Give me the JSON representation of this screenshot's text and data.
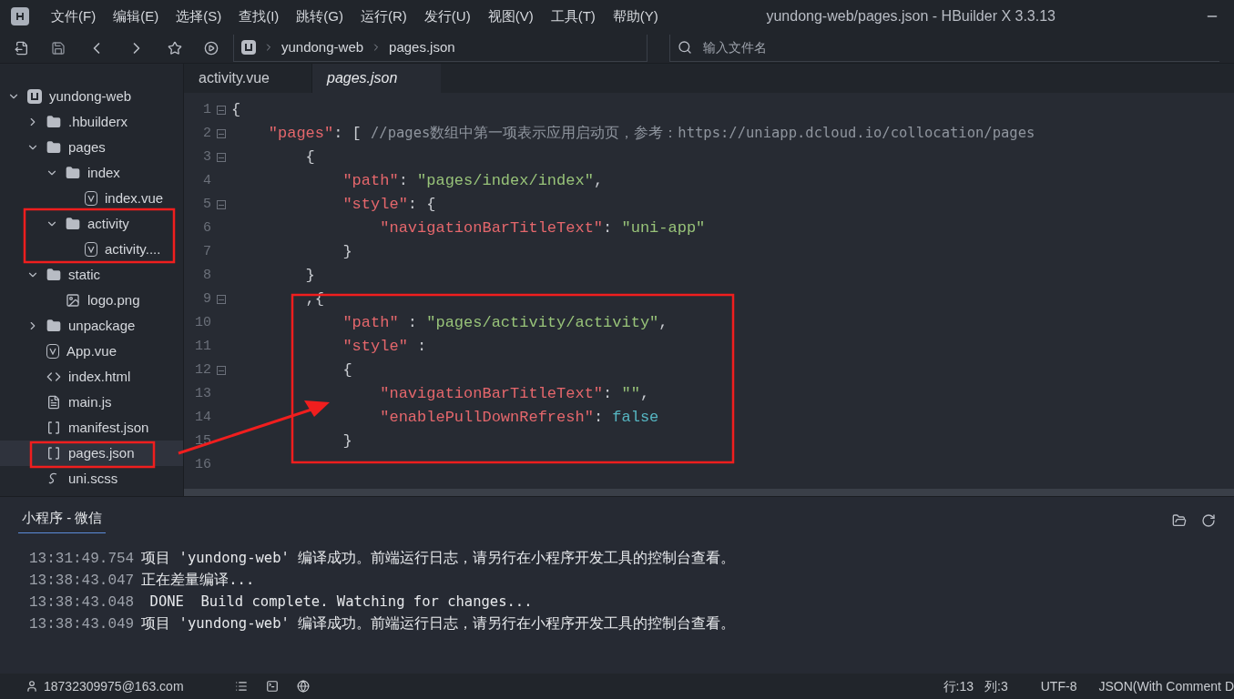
{
  "window": {
    "title": "yundong-web/pages.json - HBuilder X 3.3.13"
  },
  "menu": [
    "文件(F)",
    "编辑(E)",
    "选择(S)",
    "查找(I)",
    "跳转(G)",
    "运行(R)",
    "发行(U)",
    "视图(V)",
    "工具(T)",
    "帮助(Y)"
  ],
  "breadcrumb": [
    "yundong-web",
    "pages.json"
  ],
  "file_search": {
    "placeholder": "输入文件名"
  },
  "tree": [
    {
      "name": "yundong-web",
      "kind": "project",
      "expanded": true,
      "selected": false,
      "children": [
        {
          "name": ".hbuilderx",
          "kind": "folder",
          "expanded": false,
          "selected": false
        },
        {
          "name": "pages",
          "kind": "folder",
          "expanded": true,
          "selected": false,
          "children": [
            {
              "name": "index",
              "kind": "folder",
              "expanded": true,
              "selected": false,
              "children": [
                {
                  "name": "index.vue",
                  "kind": "vue",
                  "selected": false
                }
              ]
            },
            {
              "name": "activity",
              "kind": "folder",
              "expanded": true,
              "selected": false,
              "children": [
                {
                  "name": "activity....",
                  "kind": "vue",
                  "selected": false
                }
              ]
            }
          ]
        },
        {
          "name": "static",
          "kind": "folder",
          "expanded": true,
          "selected": false,
          "children": [
            {
              "name": "logo.png",
              "kind": "image",
              "selected": false
            }
          ]
        },
        {
          "name": "unpackage",
          "kind": "folder",
          "expanded": false,
          "selected": false
        },
        {
          "name": "App.vue",
          "kind": "vue",
          "selected": false
        },
        {
          "name": "index.html",
          "kind": "html",
          "selected": false
        },
        {
          "name": "main.js",
          "kind": "js",
          "selected": false
        },
        {
          "name": "manifest.json",
          "kind": "manifest",
          "selected": false
        },
        {
          "name": "pages.json",
          "kind": "json",
          "selected": true
        },
        {
          "name": "uni.scss",
          "kind": "scss",
          "selected": false
        }
      ]
    }
  ],
  "editor_tabs": [
    {
      "label": "activity.vue",
      "selected": false
    },
    {
      "label": "pages.json",
      "selected": true
    }
  ],
  "code_lines": [
    {
      "number": "1",
      "fold": true,
      "tokens": [
        {
          "kind": "punct",
          "text": "{"
        }
      ]
    },
    {
      "number": "2",
      "fold": true,
      "tokens": [
        {
          "kind": "key",
          "text": "    \"pages\""
        },
        {
          "kind": "punct",
          "text": ": [ "
        },
        {
          "kind": "comment",
          "text": "//pages数组中第一项表示应用启动页，参考：https://uniapp.dcloud.io/collocation/pages"
        }
      ]
    },
    {
      "number": "3",
      "fold": true,
      "tokens": [
        {
          "kind": "punct",
          "text": "        {"
        }
      ]
    },
    {
      "number": "4",
      "fold": false,
      "tokens": [
        {
          "kind": "key",
          "text": "            \"path\""
        },
        {
          "kind": "punct",
          "text": ": "
        },
        {
          "kind": "string",
          "text": "\"pages/index/index\""
        },
        {
          "kind": "punct",
          "text": ","
        }
      ]
    },
    {
      "number": "5",
      "fold": true,
      "tokens": [
        {
          "kind": "key",
          "text": "            \"style\""
        },
        {
          "kind": "punct",
          "text": ": {"
        }
      ]
    },
    {
      "number": "6",
      "fold": false,
      "tokens": [
        {
          "kind": "key",
          "text": "                \"navigationBarTitleText\""
        },
        {
          "kind": "punct",
          "text": ": "
        },
        {
          "kind": "string",
          "text": "\"uni-app\""
        }
      ]
    },
    {
      "number": "7",
      "fold": false,
      "tokens": [
        {
          "kind": "punct",
          "text": "            }"
        }
      ]
    },
    {
      "number": "8",
      "fold": false,
      "tokens": [
        {
          "kind": "punct",
          "text": "        }"
        }
      ]
    },
    {
      "number": "9",
      "fold": true,
      "tokens": [
        {
          "kind": "punct",
          "text": "        ,{"
        }
      ]
    },
    {
      "number": "10",
      "fold": false,
      "tokens": [
        {
          "kind": "key",
          "text": "            \"path\""
        },
        {
          "kind": "punct",
          "text": " : "
        },
        {
          "kind": "string",
          "text": "\"pages/activity/activity\""
        },
        {
          "kind": "punct",
          "text": ","
        }
      ]
    },
    {
      "number": "11",
      "fold": false,
      "tokens": [
        {
          "kind": "key",
          "text": "            \"style\""
        },
        {
          "kind": "punct",
          "text": " :"
        }
      ]
    },
    {
      "number": "12",
      "fold": true,
      "tokens": [
        {
          "kind": "punct",
          "text": "            {"
        }
      ]
    },
    {
      "number": "13",
      "fold": false,
      "tokens": [
        {
          "kind": "key",
          "text": "                \"navigationBarTitleText\""
        },
        {
          "kind": "punct",
          "text": ": "
        },
        {
          "kind": "string",
          "text": "\"\""
        },
        {
          "kind": "punct",
          "text": ","
        }
      ]
    },
    {
      "number": "14",
      "fold": false,
      "tokens": [
        {
          "kind": "key",
          "text": "                \"enablePullDownRefresh\""
        },
        {
          "kind": "punct",
          "text": ": "
        },
        {
          "kind": "bool",
          "text": "false"
        }
      ]
    },
    {
      "number": "15",
      "fold": false,
      "tokens": [
        {
          "kind": "punct",
          "text": "            }"
        }
      ]
    },
    {
      "number": "16",
      "fold": false
    }
  ],
  "console": {
    "tabs": [
      {
        "label": "小程序 - 微信",
        "selected": true
      }
    ],
    "lines": [
      {
        "time": "13:31:49.754",
        "message": "项目 'yundong-web' 编译成功。前端运行日志，请另行在小程序开发工具的控制台查看。"
      },
      {
        "time": "13:38:43.047",
        "message": "正在差量编译..."
      },
      {
        "time": "13:38:43.048",
        "message": " DONE  Build complete. Watching for changes..."
      },
      {
        "time": "13:38:43.049",
        "message": "项目 'yundong-web' 编译成功。前端运行日志，请另行在小程序开发工具的控制台查看。"
      }
    ]
  },
  "status_bar": {
    "account": "18732309975@163.com",
    "line": "行:13",
    "column": "列:3",
    "encoding": "UTF-8",
    "language": "JSON(With Comment D"
  }
}
